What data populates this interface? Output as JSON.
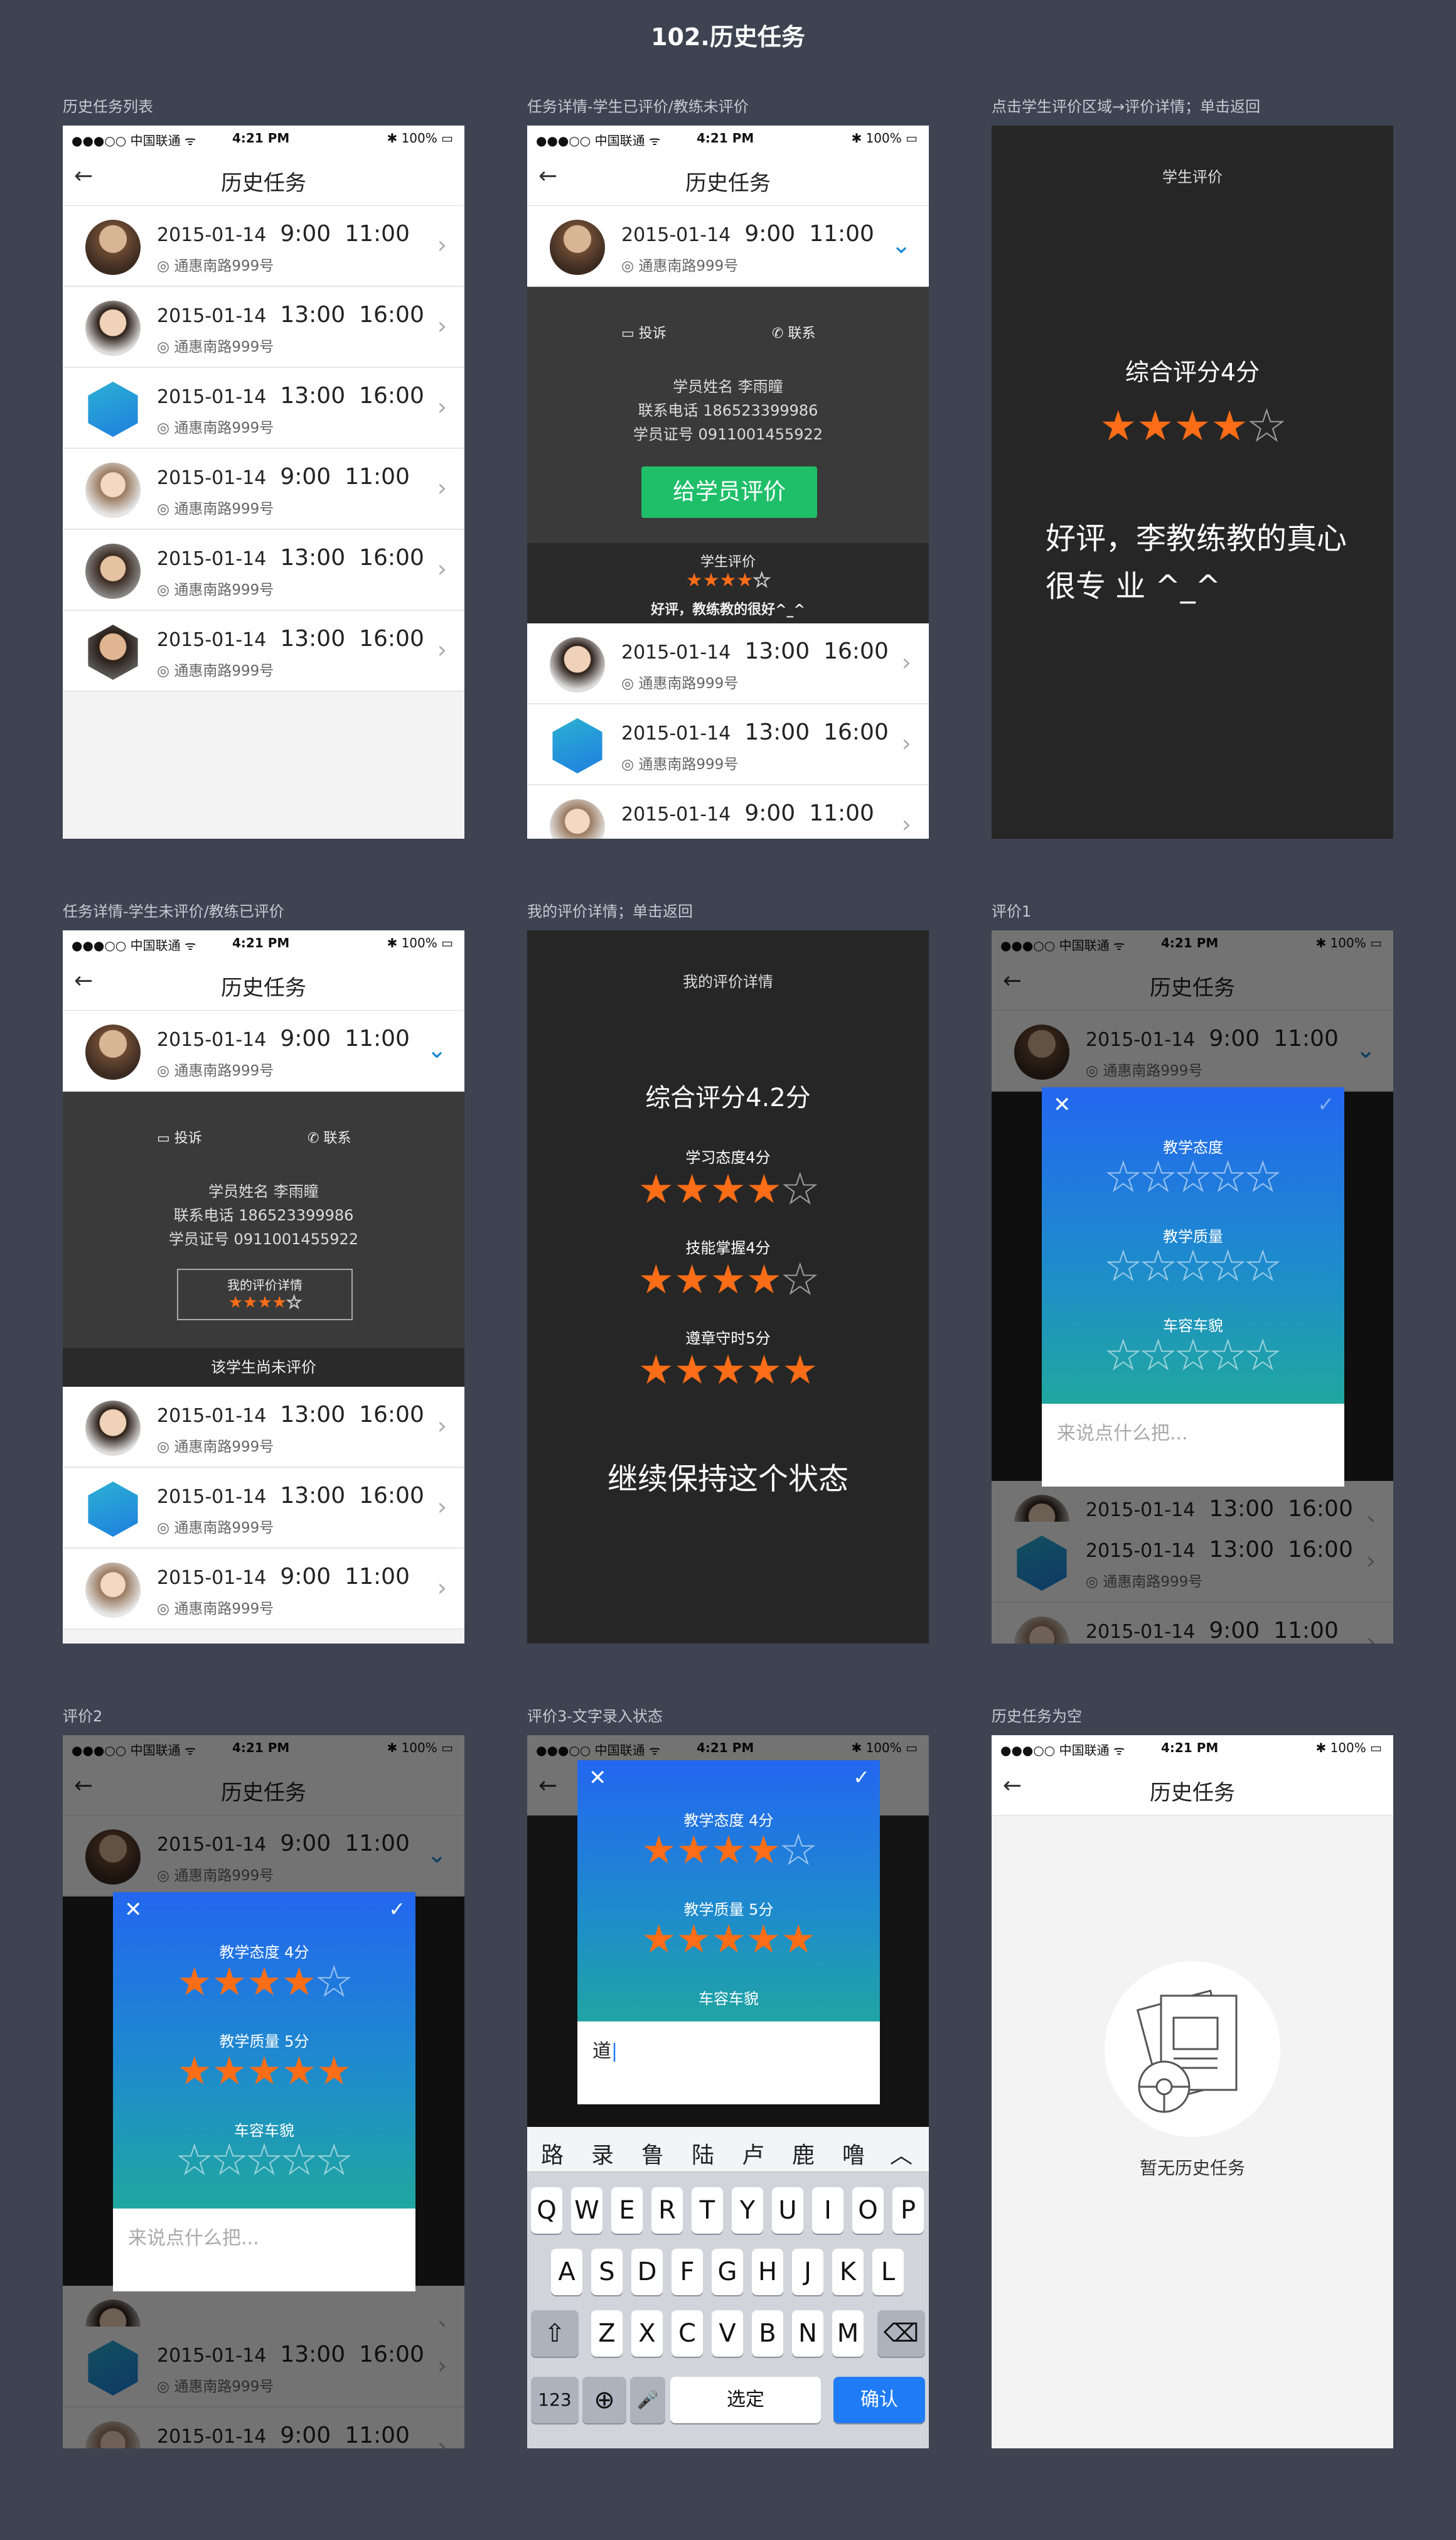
{
  "title": "102.历史任务",
  "captions": [
    "历史任务列表",
    "任务详情-学生已评价/教练未评价",
    "点击学生评价区域→评价详情；单击返回",
    "任务详情-学生未评价/教练已评价",
    "我的评价详情；单击返回",
    "评价1",
    "评价2",
    "评价3-文字录入状态",
    "历史任务为空"
  ],
  "status": {
    "carrier": "●●●○○ 中国联通 ᯤ",
    "time": "4:21 PM",
    "battery": "✱ 100% ▭"
  },
  "nav": {
    "back": "←",
    "title": "历史任务"
  },
  "address": "通惠南路999号",
  "list": [
    {
      "date": "2015-01-14",
      "start": "9:00",
      "end": "11:00"
    },
    {
      "date": "2015-01-14",
      "start": "13:00",
      "end": "16:00"
    },
    {
      "date": "2015-01-14",
      "start": "13:00",
      "end": "16:00"
    },
    {
      "date": "2015-01-14",
      "start": "9:00",
      "end": "11:00"
    },
    {
      "date": "2015-01-14",
      "start": "13:00",
      "end": "16:00"
    },
    {
      "date": "2015-01-14",
      "start": "13:00",
      "end": "16:00"
    }
  ],
  "detail": {
    "complain": "投诉",
    "contact": "联系",
    "name": "学员姓名  李雨瞳",
    "phone": "联系电话  186523399986",
    "cert": "学员证号  0911001455922",
    "rate_btn": "给学员评价",
    "student_rating_label": "学生评价",
    "student_comment": "好评，教练教的很好^_^",
    "my_eval_label": "我的评价详情",
    "not_rated": "该学生尚未评价"
  },
  "eval_detail": {
    "header": "学生评价",
    "score": "综合评分4分",
    "comment": "好评，李教练教的真心很专 业 ^_^"
  },
  "my_eval": {
    "header": "我的评价详情",
    "score": "综合评分4.2分",
    "items": [
      {
        "label": "学习态度4分",
        "stars": 4
      },
      {
        "label": "技能掌握4分",
        "stars": 4
      },
      {
        "label": "遵章守时5分",
        "stars": 5
      }
    ],
    "summary": "继续保持这个状态"
  },
  "modal": {
    "close": "✕",
    "confirm": "✓",
    "attitude": "教学态度",
    "quality": "教学质量",
    "car": "车容车貌",
    "attitude4": "教学态度 4分",
    "quality5": "教学质量 5分",
    "placeholder": "来说点什么把...",
    "typed": "道"
  },
  "keyboard": {
    "cand": [
      "路",
      "录",
      "鲁",
      "陆",
      "卢",
      "鹿",
      "噜",
      "︿"
    ],
    "row1": [
      "Q",
      "W",
      "E",
      "R",
      "T",
      "Y",
      "U",
      "I",
      "O",
      "P"
    ],
    "row2": [
      "A",
      "S",
      "D",
      "F",
      "G",
      "H",
      "J",
      "K",
      "L"
    ],
    "row3": [
      "Z",
      "X",
      "C",
      "V",
      "B",
      "N",
      "M"
    ],
    "shift": "⇧",
    "del": "⌫",
    "num": "123",
    "globe": "⊕",
    "mic": "🎤",
    "space": "选定",
    "confirm": "确认"
  },
  "empty": {
    "text": "暂无历史任务"
  }
}
